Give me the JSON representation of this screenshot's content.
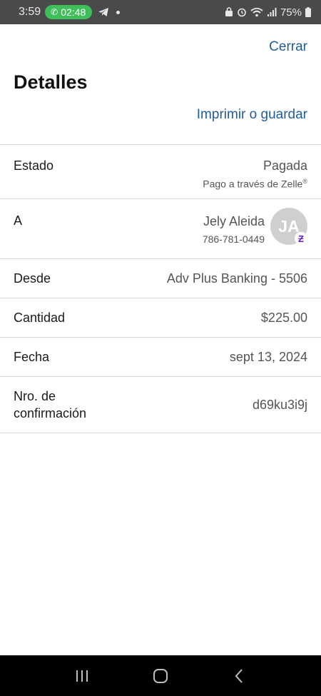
{
  "status_bar": {
    "time": "3:59",
    "call_timer": "02:48",
    "battery": "75%"
  },
  "header": {
    "close_label": "Cerrar",
    "title": "Detalles",
    "print_label": "Imprimir o guardar"
  },
  "details": {
    "estado": {
      "label": "Estado",
      "value": "Pagada",
      "sub": "Pago a través de Zelle"
    },
    "a": {
      "label": "A",
      "name": "Jely Aleida",
      "phone": "786-781-0449",
      "initials": "JA"
    },
    "desde": {
      "label": "Desde",
      "value": "Adv Plus Banking - 5506"
    },
    "cantidad": {
      "label": "Cantidad",
      "value": "$225.00"
    },
    "fecha": {
      "label": "Fecha",
      "value": "sept 13, 2024"
    },
    "confirmacion": {
      "label_line1": "Nro. de",
      "label_line2": "confirmación",
      "value": "d69ku3i9j"
    }
  },
  "icons": {
    "call": "phone-icon",
    "telegram": "telegram-icon",
    "zelle": "zelle-icon",
    "nav_recents": "recents-icon",
    "nav_home": "home-icon",
    "nav_back": "back-icon"
  },
  "colors": {
    "link": "#1f5c99",
    "call_pill": "#3fbf5a",
    "zelle": "#6d1ed4",
    "avatar_bg": "#cfcfcf"
  }
}
